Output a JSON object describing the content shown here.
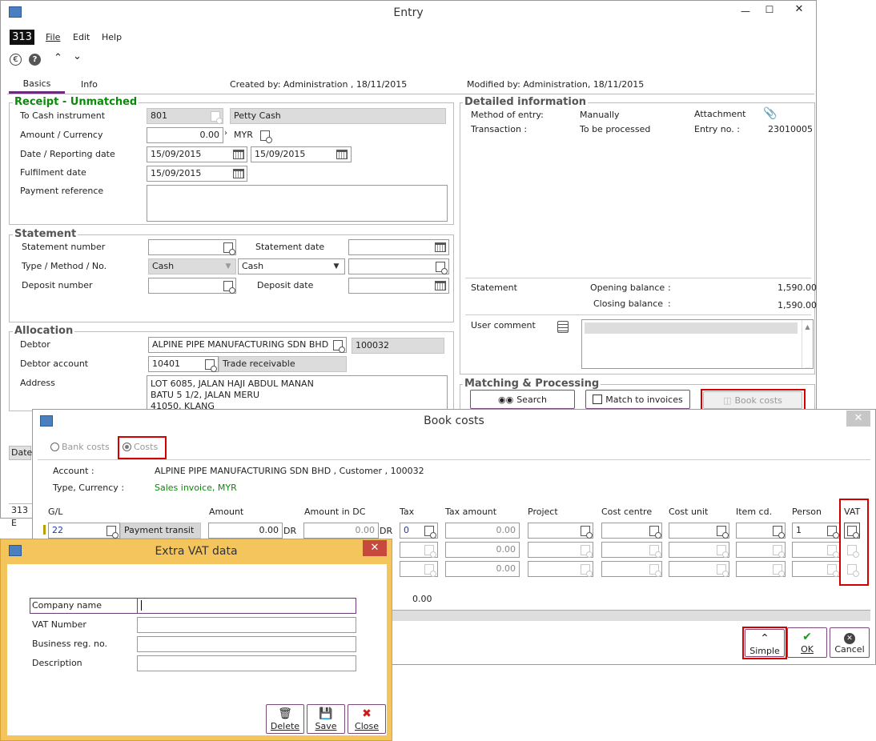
{
  "main": {
    "title": "Entry",
    "badge": "313",
    "menu": [
      "File",
      "Edit",
      "Help"
    ],
    "tabs": [
      "Basics",
      "Info"
    ],
    "created": "Created by: Administration , 18/11/2015",
    "modified": "Modified by: Administration, 18/11/2015",
    "receipt": {
      "title": "Receipt - Unmatched",
      "to_cash_label": "To Cash instrument",
      "to_cash_code": "801",
      "to_cash_name": "Petty Cash",
      "amount_label": "Amount / Currency",
      "amount": "0.00",
      "currency": "MYR",
      "date_label": "Date / Reporting date",
      "date": "15/09/2015",
      "reporting_date": "15/09/2015",
      "fulfil_label": "Fulfilment date",
      "fulfil_date": "15/09/2015",
      "payref_label": "Payment reference"
    },
    "statement": {
      "title": "Statement",
      "number_label": "Statement number",
      "date_label": "Statement date",
      "type_label": "Type / Method / No.",
      "type": "Cash",
      "method": "Cash",
      "deposit_label": "Deposit number",
      "deposit_date_label": "Deposit date"
    },
    "allocation": {
      "title": "Allocation",
      "debtor_label": "Debtor",
      "debtor_name": "ALPINE PIPE MANUFACTURING SDN BHD",
      "debtor_code": "100032",
      "account_label": "Debtor account",
      "account": "10401",
      "account_name": "Trade receivable",
      "address_label": "Address",
      "address": [
        "LOT 6085, JALAN HAJI ABDUL MANAN",
        "BATU 5 1/2, JALAN MERU",
        "41050, KLANG"
      ]
    },
    "detail": {
      "title": "Detailed information",
      "method_label": "Method of entry:",
      "method": "Manually",
      "transaction_label": "Transaction :",
      "transaction": "To be processed",
      "attachment_label": "Attachment",
      "entry_label": "Entry no. :",
      "entry_no": "23010005",
      "statement_label": "Statement",
      "opening_label": "Opening balance",
      "opening": "1,590.00",
      "closing_label": "Closing balance",
      "closing": "1,590.00",
      "colon": ":",
      "comment_label": "User comment"
    },
    "matching": {
      "title": "Matching & Processing",
      "search": "Search",
      "match": "Match to invoices",
      "book": "Book costs"
    },
    "left_col": "Date",
    "left_bottom": "313 E"
  },
  "book": {
    "title": "Book costs",
    "radio_bank": "Bank costs",
    "radio_costs": "Costs",
    "account_label": "Account :",
    "account": "ALPINE PIPE MANUFACTURING SDN BHD , Customer , 100032",
    "type_label": "Type, Currency :",
    "type": "Sales invoice, MYR",
    "headers": {
      "gl": "G/L",
      "amount": "Amount",
      "amount_dc": "Amount in DC",
      "tax": "Tax",
      "tax_amount": "Tax amount",
      "project": "Project",
      "cost_centre": "Cost centre",
      "cost_unit": "Cost unit",
      "item_cd": "Item cd.",
      "person": "Person",
      "vat": "VAT"
    },
    "row1": {
      "gl": "22",
      "gl_name": "Payment transit",
      "amount": "0.00",
      "dr": "DR",
      "amount_dc": "0.00",
      "dr2": "DR",
      "tax": "0",
      "tax_amount": "0.00",
      "person": "1"
    },
    "tax_amount2": "0.00",
    "tax_amount3": "0.00",
    "total": "0.00",
    "simple": "Simple",
    "ok": "OK",
    "cancel": "Cancel"
  },
  "vat": {
    "title": "Extra VAT data",
    "fields": [
      "Company name",
      "VAT Number",
      "Business reg. no.",
      "Description"
    ],
    "delete": "Delete",
    "save": "Save",
    "close": "Close"
  }
}
